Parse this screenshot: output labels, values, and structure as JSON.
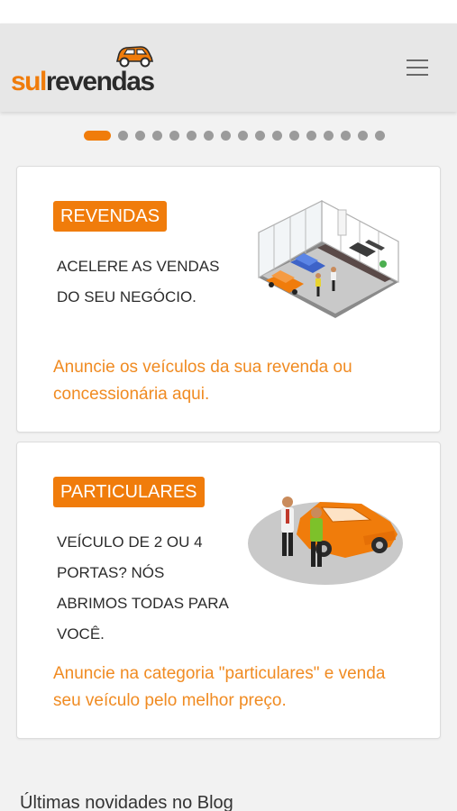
{
  "header": {
    "logo_part1": "sul",
    "logo_part2": "revendas",
    "menu_icon": "hamburger-menu-icon",
    "brand_color": "#f07c0b"
  },
  "carousel": {
    "total_slides": 17,
    "active_index": 0
  },
  "cards": [
    {
      "badge": "REVENDAS",
      "lead": "ACELERE AS VENDAS DO SEU NEGÓCIO.",
      "cta": "Anuncie os veículos da sua revenda ou concessionária aqui.",
      "illustration": "car-showroom-illustration"
    },
    {
      "badge": "PARTICULARES",
      "lead": "VEÍCULO DE 2 OU 4 PORTAS? NÓS ABRIMOS TODAS PARA VOCÊ.",
      "cta": "Anuncie na categoria \"particulares\" e venda seu veículo pelo melhor preço.",
      "illustration": "private-car-sale-illustration"
    }
  ],
  "blog": {
    "title": "Últimas novidades no Blog"
  }
}
